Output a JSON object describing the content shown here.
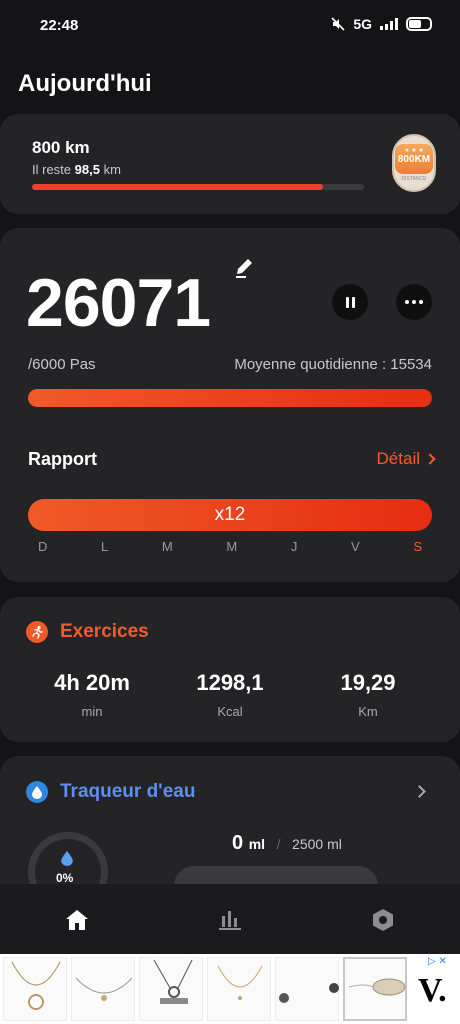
{
  "status": {
    "time": "22:48",
    "network": "5G"
  },
  "page": {
    "title": "Aujourd'hui"
  },
  "goal": {
    "title": "800 km",
    "remaining_prefix": "Il reste",
    "remaining_value": "98,5",
    "remaining_unit": "km",
    "progress_percent": 87.7,
    "badge_label": "800KM",
    "badge_sub": "DISTANCE"
  },
  "steps": {
    "count": "26071",
    "goal_text": "/6000 Pas",
    "average_text": "Moyenne quotidienne : 15534",
    "progress_percent": 100
  },
  "report": {
    "title": "Rapport",
    "detail_label": "Détail",
    "multiplier": "x12",
    "days": [
      "D",
      "L",
      "M",
      "M",
      "J",
      "V",
      "S"
    ],
    "today_index": 6
  },
  "exercise": {
    "title": "Exercices",
    "stats": [
      {
        "value": "4h 20m",
        "unit": "min"
      },
      {
        "value": "1298,1",
        "unit": "Kcal"
      },
      {
        "value": "19,29",
        "unit": "Km"
      }
    ]
  },
  "water": {
    "title": "Traqueur d'eau",
    "percent_label": "0%",
    "current_value": "0",
    "current_unit": "ml",
    "separator": "/",
    "goal": "2500 ml"
  },
  "nav": {
    "items": [
      "home-icon",
      "stats-icon",
      "settings-icon"
    ]
  },
  "colors": {
    "accent": "#f25c2c",
    "water": "#5b8ff0",
    "background": "#141416",
    "card": "#242427"
  }
}
